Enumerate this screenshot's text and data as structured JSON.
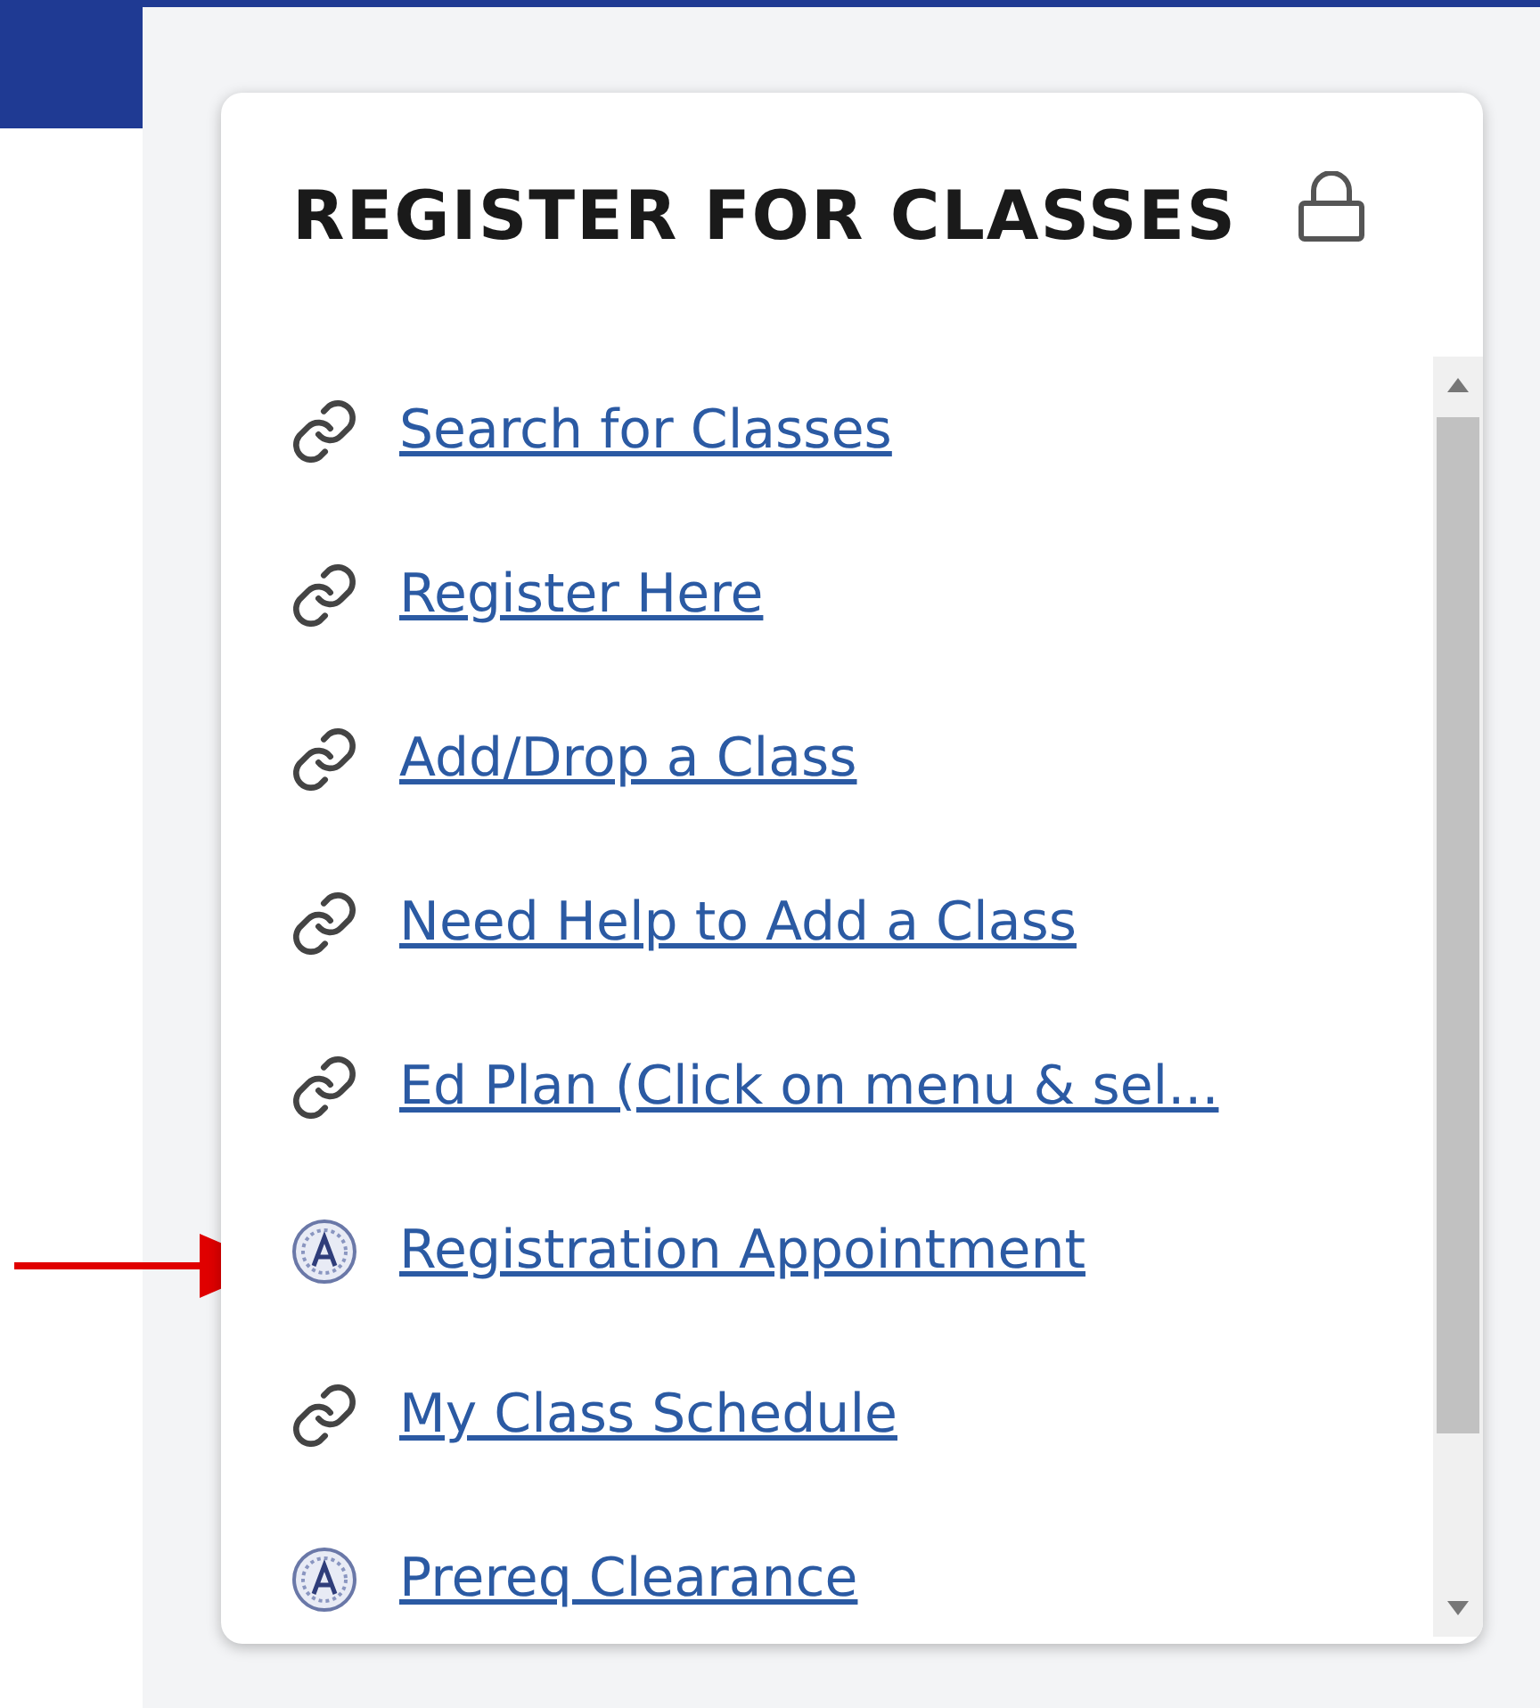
{
  "card": {
    "title": "REGISTER FOR CLASSES",
    "links": [
      {
        "label": "Search for Classes",
        "kind": "link"
      },
      {
        "label": "Register Here",
        "kind": "link"
      },
      {
        "label": "Add/Drop a Class",
        "kind": "link"
      },
      {
        "label": "Need Help to Add a Class",
        "kind": "link"
      },
      {
        "label": "Ed Plan (Click on menu & sel...",
        "kind": "link"
      },
      {
        "label": "Registration Appointment",
        "kind": "seal"
      },
      {
        "label": "My Class Schedule",
        "kind": "link"
      },
      {
        "label": "Prereq Clearance",
        "kind": "seal"
      }
    ]
  }
}
